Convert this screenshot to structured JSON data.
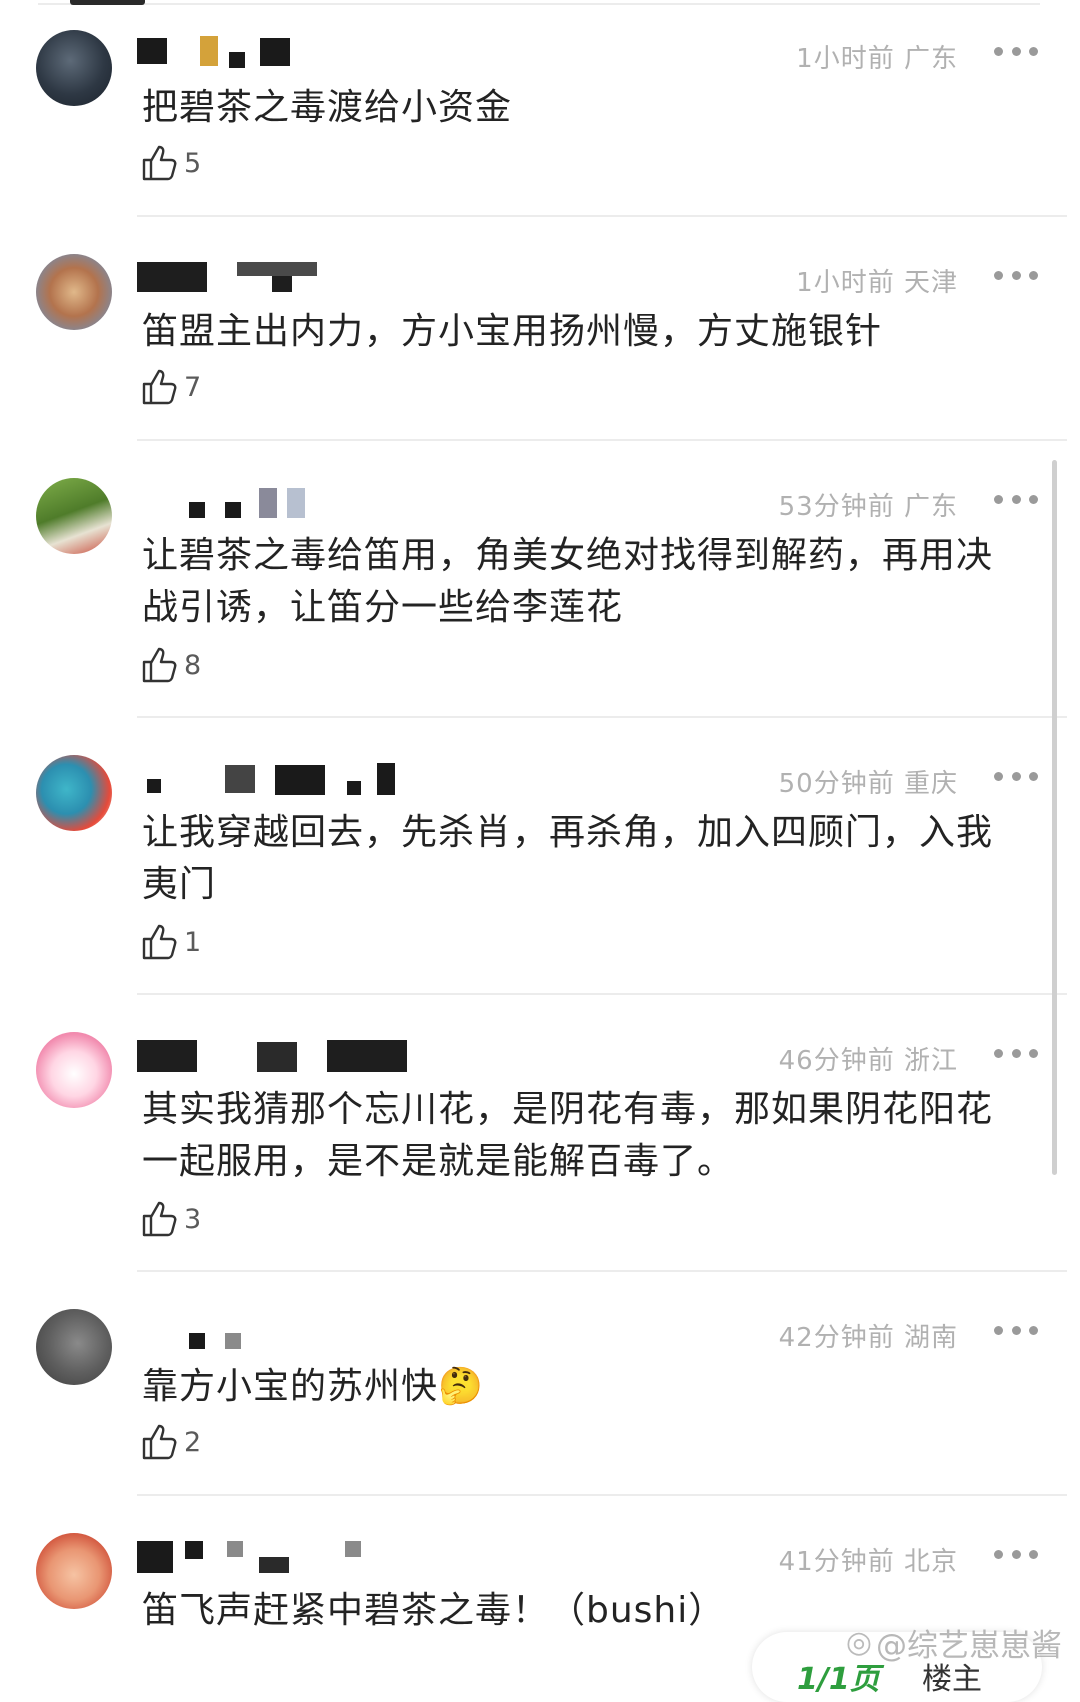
{
  "comments": [
    {
      "time": "1小时前",
      "location": "广东",
      "text": "把碧茶之毒渡给小资金",
      "likes": "5"
    },
    {
      "time": "1小时前",
      "location": "天津",
      "text": "笛盟主出内力，方小宝用扬州慢，方丈施银针",
      "likes": "7"
    },
    {
      "time": "53分钟前",
      "location": "广东",
      "text": "让碧茶之毒给笛用，角美女绝对找得到解药，再用决战引诱，让笛分一些给李莲花",
      "likes": "8"
    },
    {
      "time": "50分钟前",
      "location": "重庆",
      "text": "让我穿越回去，先杀肖，再杀角，加入四顾门，入我夷门",
      "likes": "1"
    },
    {
      "time": "46分钟前",
      "location": "浙江",
      "text": "其实我猜那个忘川花，是阴花有毒，那如果阴花阳花一起服用，是不是就是能解百毒了。",
      "likes": "3"
    },
    {
      "time": "42分钟前",
      "location": "湖南",
      "text": "靠方小宝的苏州快🤔",
      "likes": "2"
    },
    {
      "time": "41分钟前",
      "location": "北京",
      "text": "笛飞声赶紧中碧茶之毒！（bushi）",
      "likes": ""
    }
  ],
  "footer": {
    "page_indicator": "1/1页",
    "floor_label": "楼主",
    "watermark": "@综艺崽崽酱"
  },
  "colors": {
    "meta_text": "#b1b1b1",
    "body_text": "#232323",
    "divider": "#ececec",
    "page_indicator": "#2e9e3e"
  },
  "icons": [
    "thumbs-up-icon",
    "more-icon",
    "weibo-icon"
  ]
}
